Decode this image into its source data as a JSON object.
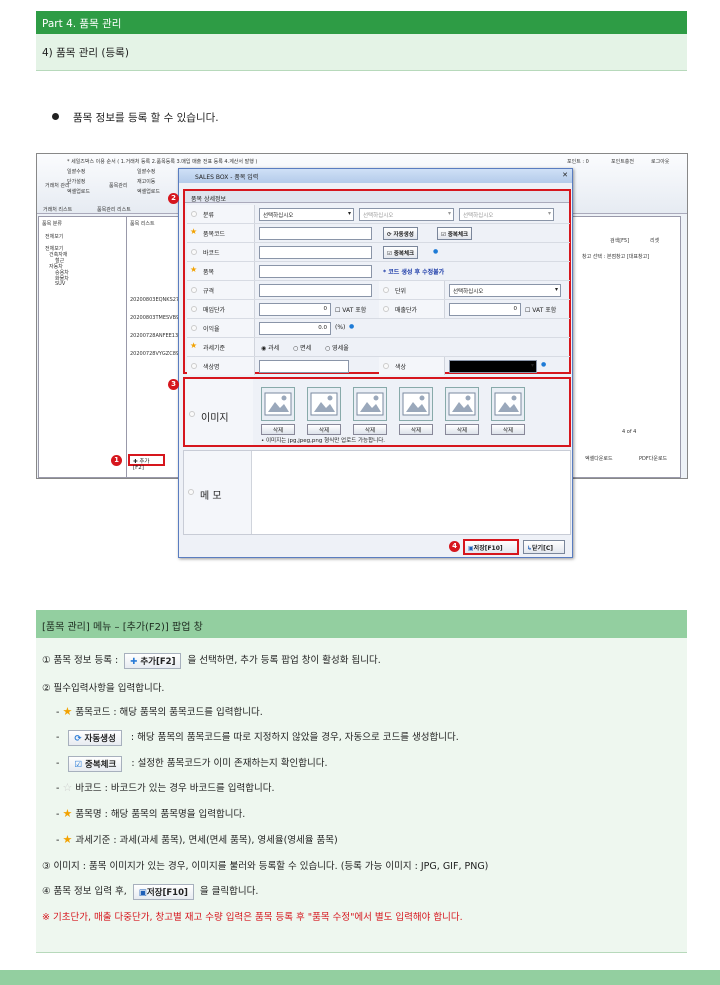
{
  "header": {
    "part": "Part 4. 품목 관리",
    "section": "4) 품목 관리 (등록)"
  },
  "intro": "품목 정보를 등록 할 수 있습니다.",
  "app": {
    "toolbar_note": "* 세일즈박스 이용 순서 ( 1.거래처 등록 2.품목등록 3.매입 매출 전표 등록 4.계산서 발행 )",
    "toolbar_items": [
      "일괄수정",
      "단가설정",
      "엑셀업로드",
      "일괄수정",
      "재고이동",
      "엑셀업로드"
    ],
    "tb_left": [
      "거래처 관리",
      "품목관리"
    ],
    "top_right": [
      "포인트 : 0",
      "포인트충전",
      "로그아웃"
    ],
    "tabs": [
      "거래처 리스트",
      "품목관리 리스트"
    ],
    "left_title": "품목 분류",
    "tree": [
      "전체보기",
      "전체보기",
      "건축자재",
      "철근",
      "자동차",
      "승용차",
      "화물차",
      "SUV"
    ],
    "list_title": "품목 리스트",
    "codes": [
      "20200803EQNKS27",
      "20200803TMESVB9",
      "20200728ANFEE13",
      "20200728VYGZC89"
    ],
    "add_btn": "추가[F2]",
    "paging": "4 of 4",
    "export": [
      "엑셀다운로드",
      "PDF다운로드"
    ],
    "right_btns": [
      "검색[F5]",
      "리셋"
    ],
    "warehouse": "창고 선택 : 본점창고 [대표창고]"
  },
  "popup": {
    "title": "SALES BOX - 품목 입력",
    "section": "품목 상세정보",
    "labels": {
      "category": "분류",
      "code": "품목코드",
      "barcode": "바코드",
      "name": "품목",
      "spec": "규격",
      "unit": "단위",
      "buy": "매입단가",
      "sell": "매출단가",
      "margin": "이익율",
      "tax": "과세기준",
      "color_name": "색상명",
      "color": "색상",
      "image": "이미지",
      "memo": "메 모"
    },
    "select_text": "선택하십시오",
    "auto_btn": "자동생성",
    "dup_btn": "중복체크",
    "dup_btn2": "중복체크",
    "note": "* 코드 생성 후 수정불가",
    "zero": "0",
    "vat": "VAT 포함",
    "margin_val": "0.0",
    "pct": "(%)",
    "tax_opts": [
      "과세",
      "면세",
      "영세율"
    ],
    "del": "삭제",
    "img_note": "• 이미지는 jpg,jpeg,png 형식만 업로드 가능합니다.",
    "save": "저장[F10]",
    "close": "닫기[C]"
  },
  "explain": {
    "title": "[품목 관리] 메뉴 – [추가(F2)] 팝업 창",
    "l1a": "①  품목 정보 등록 :",
    "l1btn": "추가[F2]",
    "l1b": "을 선택하면, 추가 등록 팝업 창이 활성화 됩니다.",
    "l2": "②  필수입력사항을 입력합니다.",
    "l3": "품목코드 : 해당 품목의 품목코드를 입력합니다.",
    "l4btn": "자동생성",
    "l4": ": 해당 품목의 품목코드를 따로 지정하지 않았을 경우, 자동으로 코드를 생성합니다.",
    "l5btn": "중복체크",
    "l5": ": 설정한 품목코드가 이미 존재하는지 확인합니다.",
    "l6": "바코드 : 바코드가 있는 경우 바코드를 입력합니다.",
    "l7": "품목명 : 해당 품목의 품목명을 입력합니다.",
    "l8": "과세기준 : 과세(과세 품목), 면세(면세 품목), 영세율(영세율 품목)",
    "l9": "③  이미지 : 품목 이미지가 있는 경우, 이미지를 불러와 등록할 수 있습니다. (등록 가능 이미지 : JPG, GIF, PNG)",
    "l10a": "④  품목 정보 입력 후,",
    "l10btn": "저장[F10]",
    "l10b": "을 클릭합니다.",
    "l11": "※ 기초단가, 매출 다중단가, 창고별 재고 수량 입력은  품목 등록 후 \"품목 수정\"에서 별도 입력해야 합니다."
  },
  "markers": [
    "1",
    "2",
    "3",
    "4"
  ]
}
